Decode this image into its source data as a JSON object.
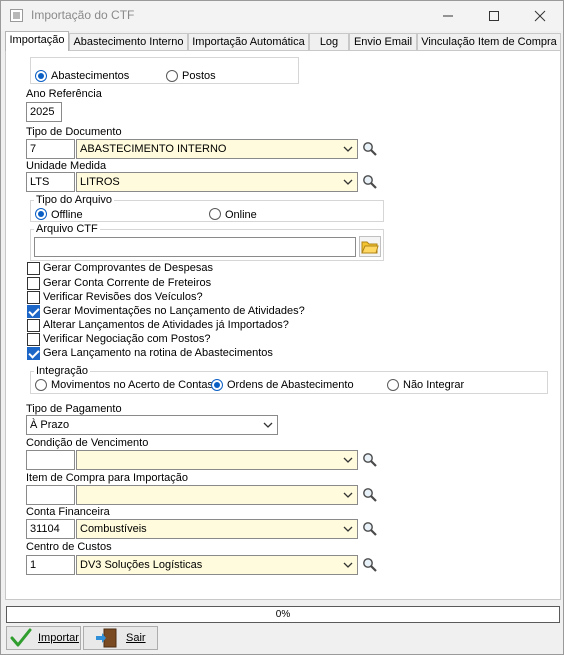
{
  "window": {
    "title": "Importação do CTF"
  },
  "tabs": [
    {
      "label": "Importação"
    },
    {
      "label": "Abastecimento Interno"
    },
    {
      "label": "Importação Automática"
    },
    {
      "label": "Log"
    },
    {
      "label": "Envio Email"
    },
    {
      "label": "Vinculação Item de Compra"
    }
  ],
  "source": {
    "opt1": "Abastecimentos",
    "opt2": "Postos",
    "selected": "Abastecimentos"
  },
  "ano": {
    "label": "Ano Referência",
    "value": "2025"
  },
  "tipo_documento": {
    "label": "Tipo de Documento",
    "code": "7",
    "value": "ABASTECIMENTO INTERNO"
  },
  "unidade": {
    "label": "Unidade Medida",
    "code": "LTS",
    "value": "LITROS"
  },
  "tipo_arquivo": {
    "title": "Tipo do Arquivo",
    "opt1": "Offline",
    "opt2": "Online",
    "selected": "Offline"
  },
  "arquivo": {
    "title": "Arquivo CTF",
    "value": ""
  },
  "checks": [
    {
      "label": "Gerar Comprovantes de Despesas",
      "checked": false
    },
    {
      "label": "Gerar Conta Corrente de Freteiros",
      "checked": false
    },
    {
      "label": "Verificar Revisões dos Veículos?",
      "checked": false
    },
    {
      "label": "Gerar Movimentações no Lançamento de Atividades?",
      "checked": true
    },
    {
      "label": "Alterar Lançamentos de Atividades já Importados?",
      "checked": false
    },
    {
      "label": "Verificar Negociação com Postos?",
      "checked": false
    },
    {
      "label": "Gera Lançamento na rotina de Abastecimentos",
      "checked": true
    }
  ],
  "integracao": {
    "title": "Integração",
    "opt1": "Movimentos no Acerto de Contas",
    "opt2": "Ordens de Abastecimento",
    "opt3": "Não Integrar",
    "selected": "Ordens de Abastecimento"
  },
  "tipo_pagamento": {
    "label": "Tipo de Pagamento",
    "value": "À Prazo"
  },
  "condicao": {
    "label": "Condição de Vencimento",
    "code": "",
    "value": ""
  },
  "item_compra": {
    "label": "Item de Compra para Importação",
    "code": "",
    "value": ""
  },
  "conta": {
    "label": "Conta Financeira",
    "code": "31104",
    "value": "Combustíveis"
  },
  "centro": {
    "label": "Centro de Custos",
    "code": "1",
    "value": "DV3 Soluções Logísticas"
  },
  "progress": {
    "text": "0%",
    "value": 0
  },
  "buttons": {
    "importar": "Importar",
    "sair": "Sair"
  },
  "icons": {
    "search": "search-icon",
    "folder": "folder-icon",
    "check": "check-icon",
    "exit": "exit-door-icon"
  }
}
